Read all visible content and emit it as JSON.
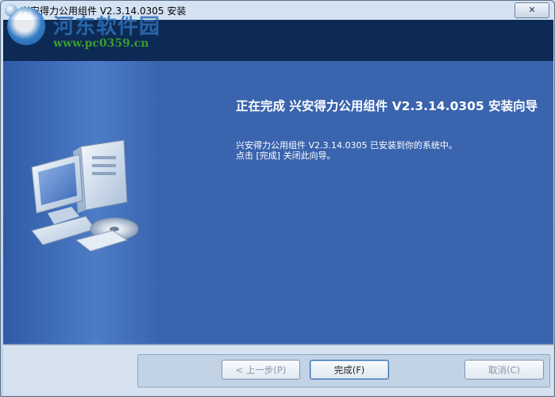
{
  "window": {
    "title": "兴安得力公用组件 V2.3.14.0305 安装",
    "close_label": "✕"
  },
  "watermark": {
    "logo_text": "河东软件园",
    "url": "www.pc0359.cn"
  },
  "page": {
    "heading": "正在完成 兴安得力公用组件 V2.3.14.0305 安装向导",
    "lines": [
      "兴安得力公用组件 V2.3.14.0305 已安装到你的系统中。",
      "点击 [完成] 关闭此向导。"
    ]
  },
  "buttons": {
    "back": "< 上一步(P)",
    "finish": "完成(F)",
    "cancel": "取消(C)"
  },
  "colors": {
    "header_band": "#0d2a55",
    "content_bg": "#3a64ae",
    "button_face": "#dfe8f2"
  },
  "icons": [
    "installer-app-icon",
    "computer-illustration",
    "close-icon"
  ]
}
